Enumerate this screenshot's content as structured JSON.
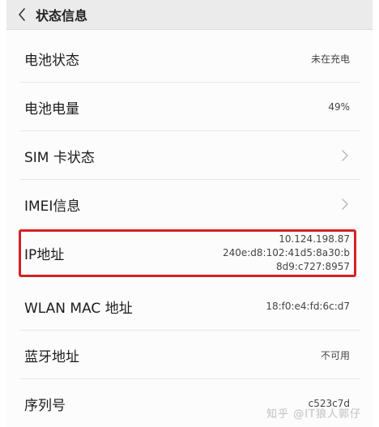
{
  "header": {
    "title": "状态信息"
  },
  "rows": [
    {
      "label": "电池状态",
      "value": "未在充电"
    },
    {
      "label": "电池电量",
      "value": "49%"
    },
    {
      "label": "SIM 卡状态"
    },
    {
      "label": "IMEI信息"
    },
    {
      "label": "IP地址",
      "value_lines": [
        "10.124.198.87",
        "240e:d8:102:41d5:8a30:b",
        "8d9:c727:8957"
      ]
    },
    {
      "label": "WLAN MAC 地址",
      "value": "18:f0:e4:fd:6c:d7"
    },
    {
      "label": "蓝牙地址",
      "value": "不可用"
    },
    {
      "label": "序列号",
      "value": "c523c7d"
    }
  ],
  "watermark": "知乎 @IT狼人郭仔",
  "colors": {
    "header_bg": "#ebebeb",
    "highlight_border": "#d81f26"
  },
  "icons": {
    "back": "chevron-left-icon",
    "row_arrow": "chevron-right-icon"
  }
}
